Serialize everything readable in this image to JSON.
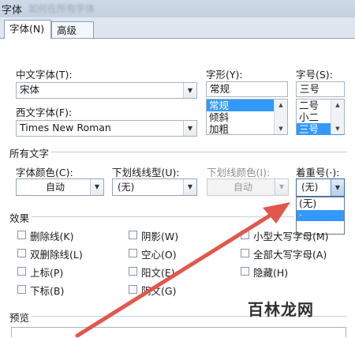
{
  "window": {
    "title": "字体",
    "title_blurred": "如何在所有字体"
  },
  "tabs": [
    {
      "label": "字体(N)",
      "active": true
    },
    {
      "label": "高级(V)",
      "active": false
    }
  ],
  "font": {
    "chinese_label": "中文字体(T):",
    "chinese_value": "宋体",
    "western_label": "西文字体(F):",
    "western_value": "Times New Roman",
    "style_label": "字形(Y):",
    "style_value": "常规",
    "style_items": [
      "常规",
      "倾斜",
      "加粗"
    ],
    "style_selected": 0,
    "size_label": "字号(S):",
    "size_value": "三号",
    "size_items": [
      "二号",
      "小二",
      "三号"
    ],
    "size_selected": 2
  },
  "all_text": {
    "section_label": "所有文字",
    "color_label": "字体颜色(C):",
    "color_value": "自动",
    "underline_label": "下划线线型(U):",
    "underline_value": "(无)",
    "underline_color_label": "下划线颜色(I):",
    "underline_color_value": "自动",
    "emphasis_label": "着重号(·):",
    "emphasis_value": "(无)",
    "emphasis_options": [
      "(无)",
      "·"
    ],
    "emphasis_highlighted": 1
  },
  "effects": {
    "section_label": "效果",
    "items": [
      "删除线(K)",
      "阴影(W)",
      "小型大写字母(M)",
      "双删除线(L)",
      "空心(O)",
      "全部大写字母(A)",
      "上标(P)",
      "阳文(E)",
      "隐藏(H)",
      "下标(B)",
      "阴文(G)"
    ]
  },
  "preview": {
    "section_label": "预览"
  },
  "watermark": {
    "text": "百林龙网"
  },
  "colors": {
    "accent": "#3399ff",
    "arrow": "#e2574c",
    "panel": "#ffffff",
    "frame": "#dfe6ef"
  }
}
